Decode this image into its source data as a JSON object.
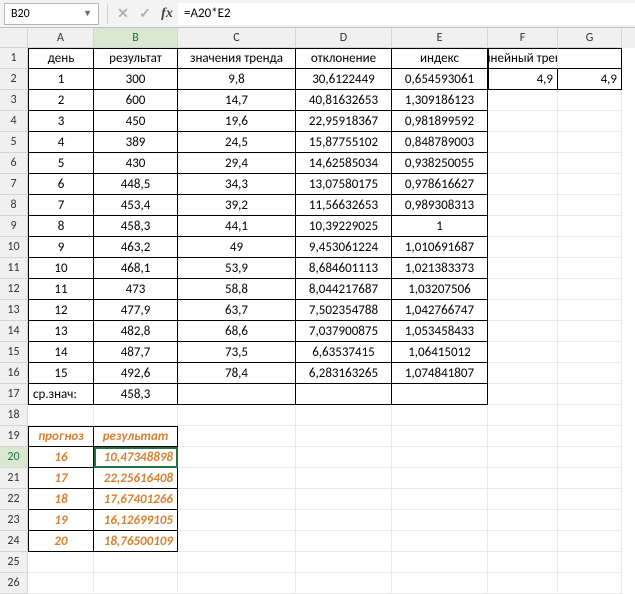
{
  "name_box": "B20",
  "formula": "=A20*E2",
  "col_labels": [
    "A",
    "B",
    "C",
    "D",
    "E",
    "F",
    "G"
  ],
  "col_widths": [
    "c-A",
    "c-B",
    "c-C",
    "c-D",
    "c-E",
    "c-F",
    "c-G"
  ],
  "active": {
    "row": 20,
    "col": 1
  },
  "headers": {
    "A": "день",
    "B": "результат",
    "C": "значения тренда",
    "D": "отклонение",
    "E": "индекс",
    "FG": "линейный тренд"
  },
  "table": [
    {
      "A": "1",
      "B": "300",
      "C": "9,8",
      "D": "30,6122449",
      "E": "0,654593061",
      "F": "4,9",
      "G": "4,9"
    },
    {
      "A": "2",
      "B": "600",
      "C": "14,7",
      "D": "40,81632653",
      "E": "1,309186123"
    },
    {
      "A": "3",
      "B": "450",
      "C": "19,6",
      "D": "22,95918367",
      "E": "0,981899592"
    },
    {
      "A": "4",
      "B": "389",
      "C": "24,5",
      "D": "15,87755102",
      "E": "0,848789003"
    },
    {
      "A": "5",
      "B": "430",
      "C": "29,4",
      "D": "14,62585034",
      "E": "0,938250055"
    },
    {
      "A": "6",
      "B": "448,5",
      "C": "34,3",
      "D": "13,07580175",
      "E": "0,978616627"
    },
    {
      "A": "7",
      "B": "453,4",
      "C": "39,2",
      "D": "11,56632653",
      "E": "0,989308313"
    },
    {
      "A": "8",
      "B": "458,3",
      "C": "44,1",
      "D": "10,39229025",
      "E": "1"
    },
    {
      "A": "9",
      "B": "463,2",
      "C": "49",
      "D": "9,453061224",
      "E": "1,010691687"
    },
    {
      "A": "10",
      "B": "468,1",
      "C": "53,9",
      "D": "8,684601113",
      "E": "1,021383373"
    },
    {
      "A": "11",
      "B": "473",
      "C": "58,8",
      "D": "8,044217687",
      "E": "1,03207506"
    },
    {
      "A": "12",
      "B": "477,9",
      "C": "63,7",
      "D": "7,502354788",
      "E": "1,042766747"
    },
    {
      "A": "13",
      "B": "482,8",
      "C": "68,6",
      "D": "7,037900875",
      "E": "1,053458433"
    },
    {
      "A": "14",
      "B": "487,7",
      "C": "73,5",
      "D": "6,63537415",
      "E": "1,06415012"
    },
    {
      "A": "15",
      "B": "492,6",
      "C": "78,4",
      "D": "6,283163265",
      "E": "1,074841807"
    }
  ],
  "avg_row": {
    "A": "ср.знач:",
    "B": "458,3"
  },
  "forecast_header": {
    "A": "прогноз",
    "B": "результат"
  },
  "forecast": [
    {
      "A": "16",
      "B": "10,47348898"
    },
    {
      "A": "17",
      "B": "22,25616408"
    },
    {
      "A": "18",
      "B": "17,67401266"
    },
    {
      "A": "19",
      "B": "16,12699105"
    },
    {
      "A": "20",
      "B": "18,76500109"
    }
  ],
  "row_count": 26
}
